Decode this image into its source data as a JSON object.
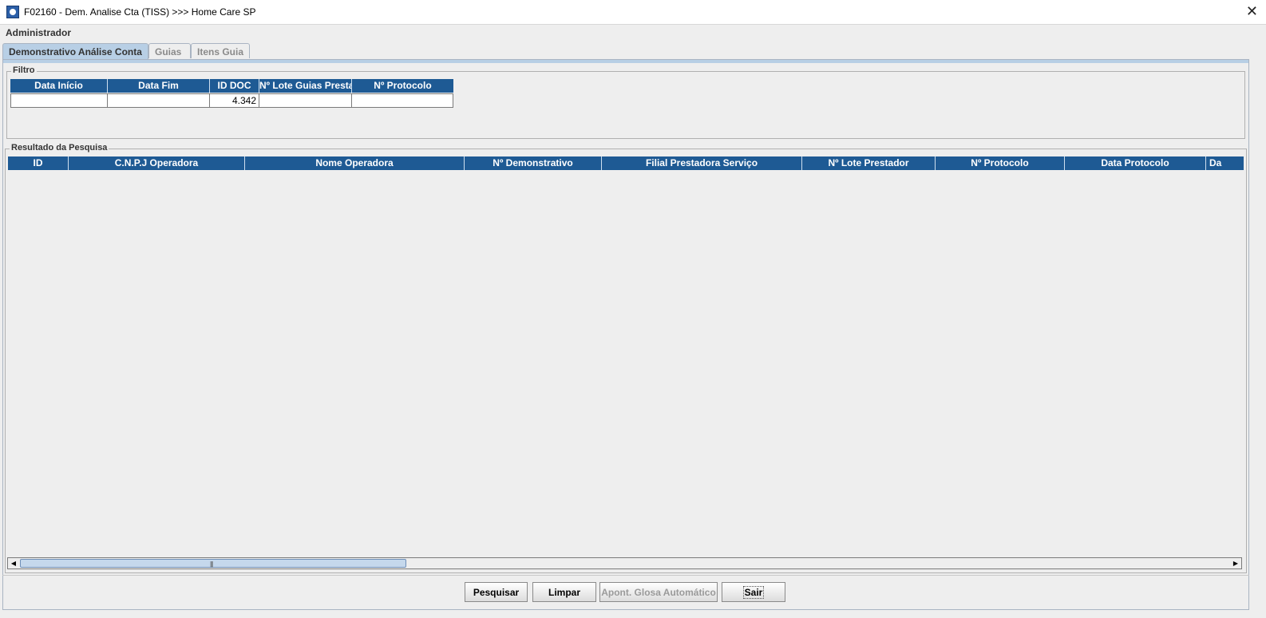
{
  "window": {
    "title": "F02160 - Dem. Analise Cta (TISS) >>> Home Care SP",
    "close_glyph": "✕"
  },
  "user": "Administrador",
  "tabs": [
    {
      "label": "Demonstrativo Análise Conta",
      "active": true
    },
    {
      "label": "Guias",
      "active": false
    },
    {
      "label": "Itens Guia",
      "active": false
    }
  ],
  "filter": {
    "group_label": "Filtro",
    "columns": [
      "Data Início",
      "Data Fim",
      "ID DOC",
      "Nº Lote Guias Presta",
      "Nº Protocolo"
    ],
    "values": [
      "",
      "",
      "4.342",
      "",
      ""
    ]
  },
  "results": {
    "group_label": "Resultado da Pesquisa",
    "columns": [
      "ID",
      "C.N.P.J Operadora",
      "Nome Operadora",
      "Nº Demonstrativo",
      "Filial Prestadora Serviço",
      "Nº Lote Prestador",
      "Nº Protocolo",
      "Data Protocolo",
      "Da"
    ],
    "rows": []
  },
  "scrollbar": {
    "left_arrow": "◀",
    "right_arrow": "▶",
    "grip": "|||"
  },
  "buttons": {
    "search": "Pesquisar",
    "clear": "Limpar",
    "auto_gloss": "Apont. Glosa Automático",
    "exit": "Sair"
  }
}
